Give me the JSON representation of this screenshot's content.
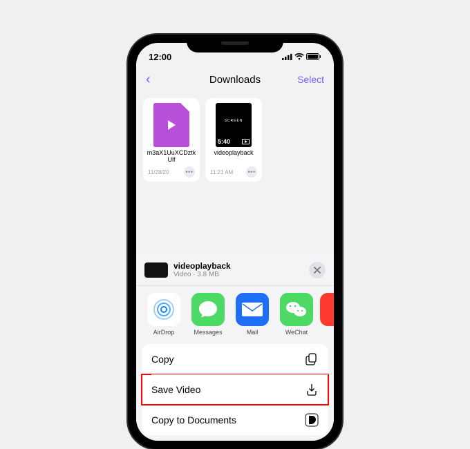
{
  "status": {
    "time": "12:00"
  },
  "nav": {
    "title": "Downloads",
    "select": "Select"
  },
  "files": [
    {
      "name": "m3aX1UuXCDztkUlf",
      "date": "11/28/20"
    },
    {
      "name": "videoplayback",
      "date": "11:21 AM",
      "duration": "5:40"
    }
  ],
  "sheet": {
    "title": "videoplayback",
    "subtitle": "Video · 3.8 MB"
  },
  "apps": [
    {
      "label": "AirDrop"
    },
    {
      "label": "Messages"
    },
    {
      "label": "Mail"
    },
    {
      "label": "WeChat"
    }
  ],
  "actions": {
    "copy": "Copy",
    "save": "Save Video",
    "docs": "Copy to Documents"
  }
}
